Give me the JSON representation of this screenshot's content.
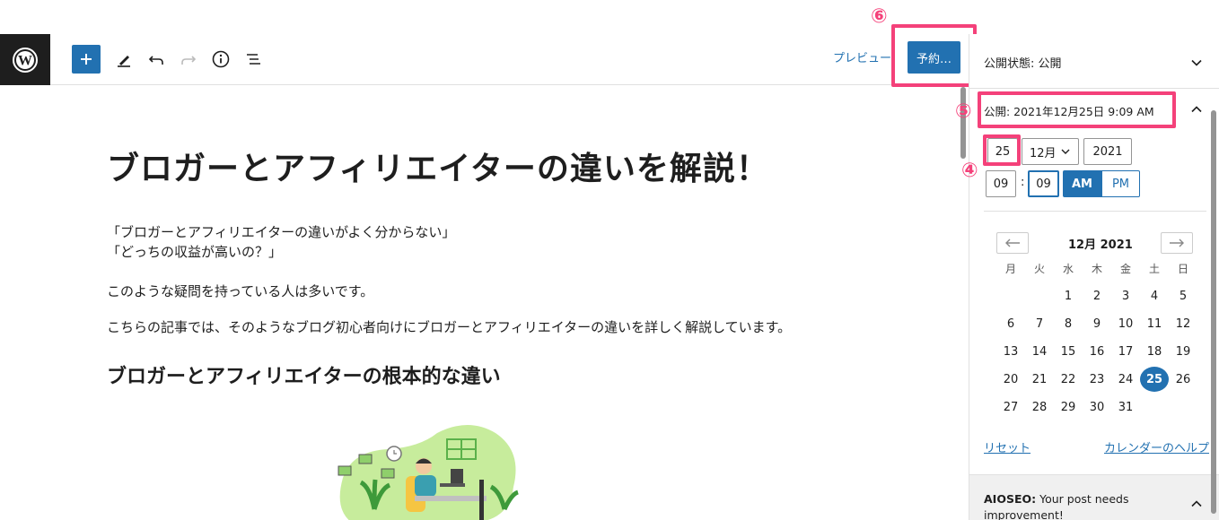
{
  "toolbar": {
    "preview_label": "プレビュー",
    "publish_label": "予約…"
  },
  "annotations": {
    "n4": "④",
    "n5": "⑤",
    "n6": "⑥"
  },
  "post": {
    "title": "ブロガーとアフィリエイターの違いを解説！",
    "paragraphs": [
      "「ブロガーとアフィリエイターの違いがよく分からない」",
      "「どっちの収益が高いの？」",
      "このような疑問を持っている人は多いです。",
      "こちらの記事では、そのようなブログ初心者向けにブロガーとアフィリエイターの違いを詳しく解説しています。"
    ],
    "heading2": "ブロガーとアフィリエイターの根本的な違い"
  },
  "sidebar": {
    "visibility_label": "公開状態: 公開",
    "publish_date_label": "公開: 2021年12月25日 9:09 AM",
    "date": {
      "day": "25",
      "month": "12月",
      "year": "2021"
    },
    "time": {
      "hour": "09",
      "separator": ":",
      "minute": "09",
      "am": "AM",
      "pm": "PM"
    },
    "calendar": {
      "month_label": "12月 2021",
      "prev": "←",
      "next": "→",
      "weekdays": [
        "月",
        "火",
        "水",
        "木",
        "金",
        "土",
        "日"
      ],
      "weeks": [
        [
          "",
          "",
          "1",
          "2",
          "3",
          "4",
          "5"
        ],
        [
          "6",
          "7",
          "8",
          "9",
          "10",
          "11",
          "12"
        ],
        [
          "13",
          "14",
          "15",
          "16",
          "17",
          "18",
          "19"
        ],
        [
          "20",
          "21",
          "22",
          "23",
          "24",
          "25",
          "26"
        ],
        [
          "27",
          "28",
          "29",
          "30",
          "31",
          "",
          ""
        ]
      ],
      "selected_day": "25"
    },
    "reset_label": "リセット",
    "help_label": "カレンダーのヘルプ",
    "seo_label": "AIOSEO:",
    "seo_text": " Your post needs improvement!"
  },
  "colors": {
    "accent": "#2271b1",
    "highlight": "#f4417a",
    "dark": "#1e1e1e"
  }
}
